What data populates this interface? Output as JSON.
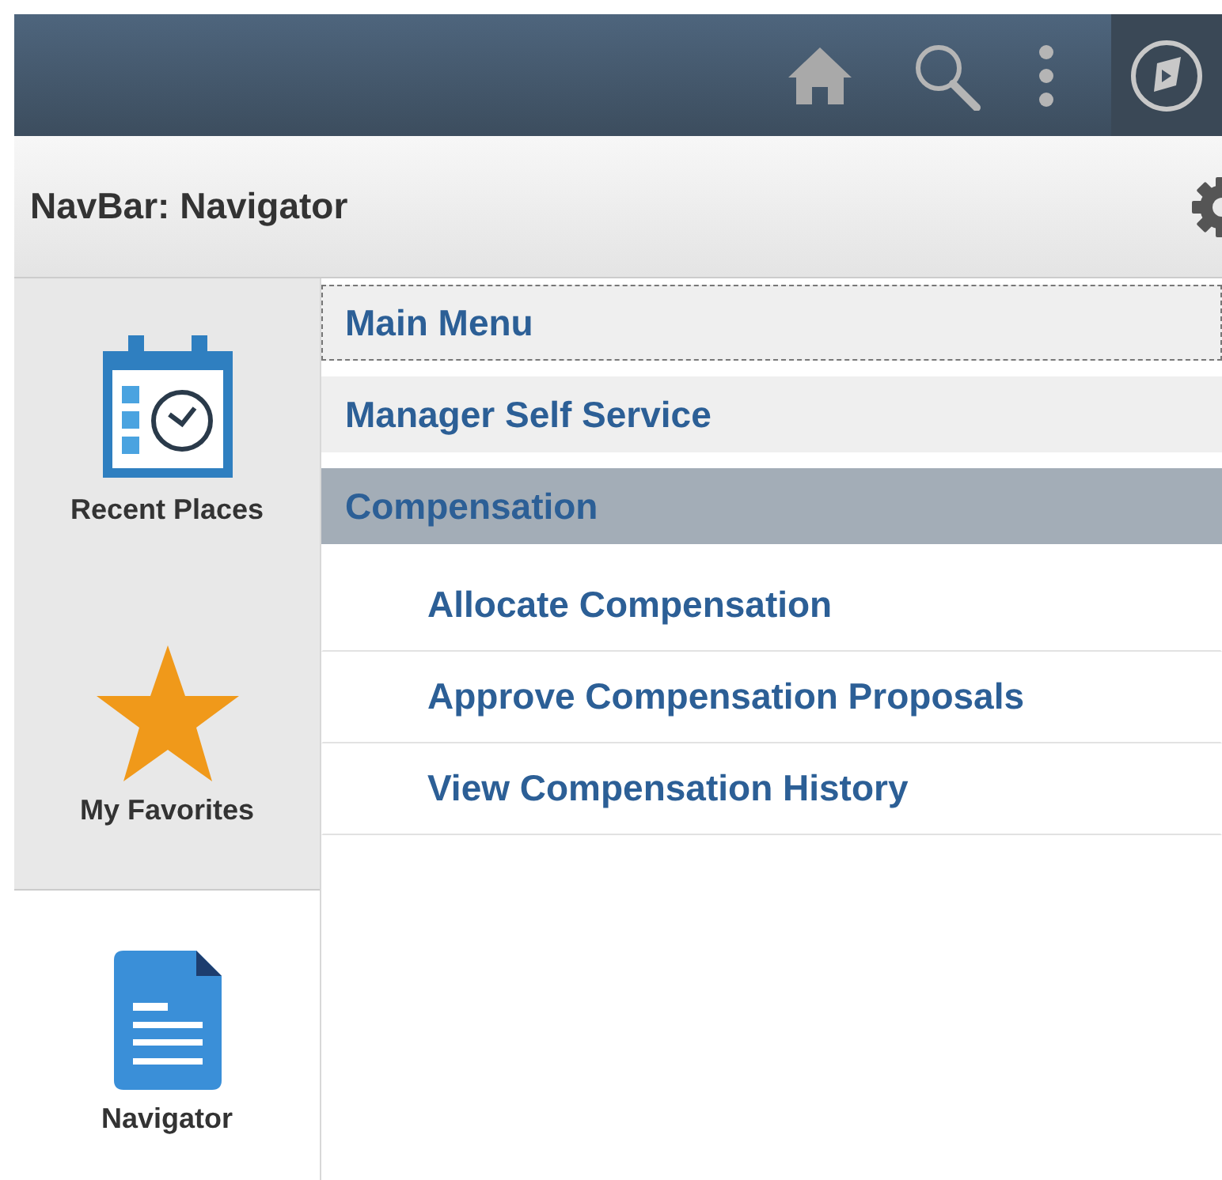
{
  "header": {
    "title": "NavBar: Navigator"
  },
  "sidebar": {
    "items": [
      {
        "label": "Recent Places",
        "kind": "calendar",
        "selected": false
      },
      {
        "label": "My Favorites",
        "kind": "star",
        "selected": false
      },
      {
        "label": "Navigator",
        "kind": "document",
        "selected": true
      }
    ]
  },
  "menu": {
    "items": [
      {
        "label": "Main Menu",
        "selected": false,
        "focused": true
      },
      {
        "label": "Manager Self Service",
        "selected": false,
        "focused": false
      },
      {
        "label": "Compensation",
        "selected": true,
        "focused": false,
        "children": [
          {
            "label": "Allocate Compensation",
            "selected": false,
            "focused": false
          },
          {
            "label": "Approve Compensation Proposals",
            "selected": false,
            "focused": false
          },
          {
            "label": "View Compensation History",
            "selected": false,
            "focused": false
          }
        ]
      }
    ]
  }
}
